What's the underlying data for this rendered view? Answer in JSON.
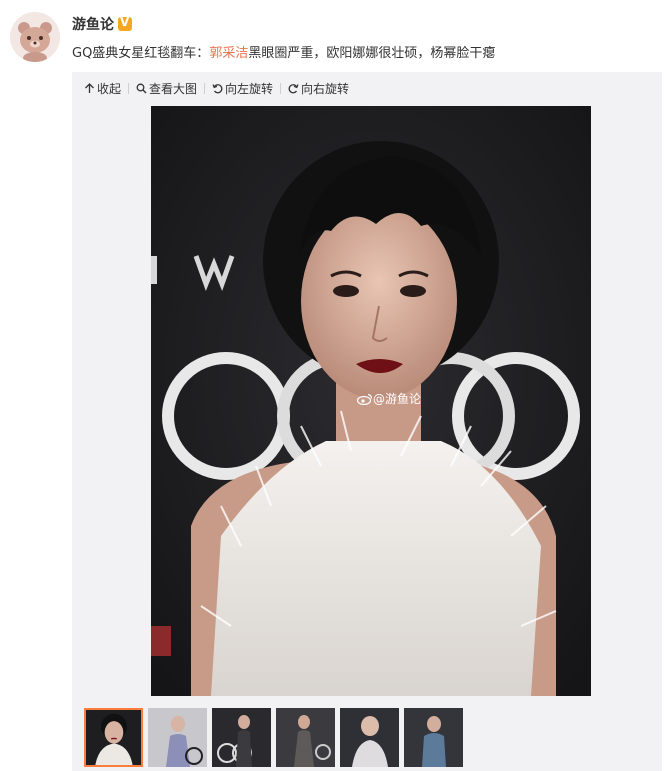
{
  "user": {
    "name": "游鱼论",
    "badge": "V"
  },
  "post": {
    "prefix": "GQ盛典女星红毯翻车：",
    "highlight": "郭采洁",
    "suffix": "黑眼圈严重，欧阳娜娜很壮硕，杨幂脸干瘪"
  },
  "toolbar": {
    "collapse": "收起",
    "view_large": "查看大图",
    "rotate_left": "向左旋转",
    "rotate_right": "向右旋转"
  },
  "photo": {
    "watermark": "@游鱼论"
  },
  "thumbnails": {
    "count": 6,
    "selected": 1
  },
  "colors": {
    "highlight": "#eb7350",
    "thumb_border": "#fa7d3c",
    "panel_bg": "#f2f2f5"
  }
}
